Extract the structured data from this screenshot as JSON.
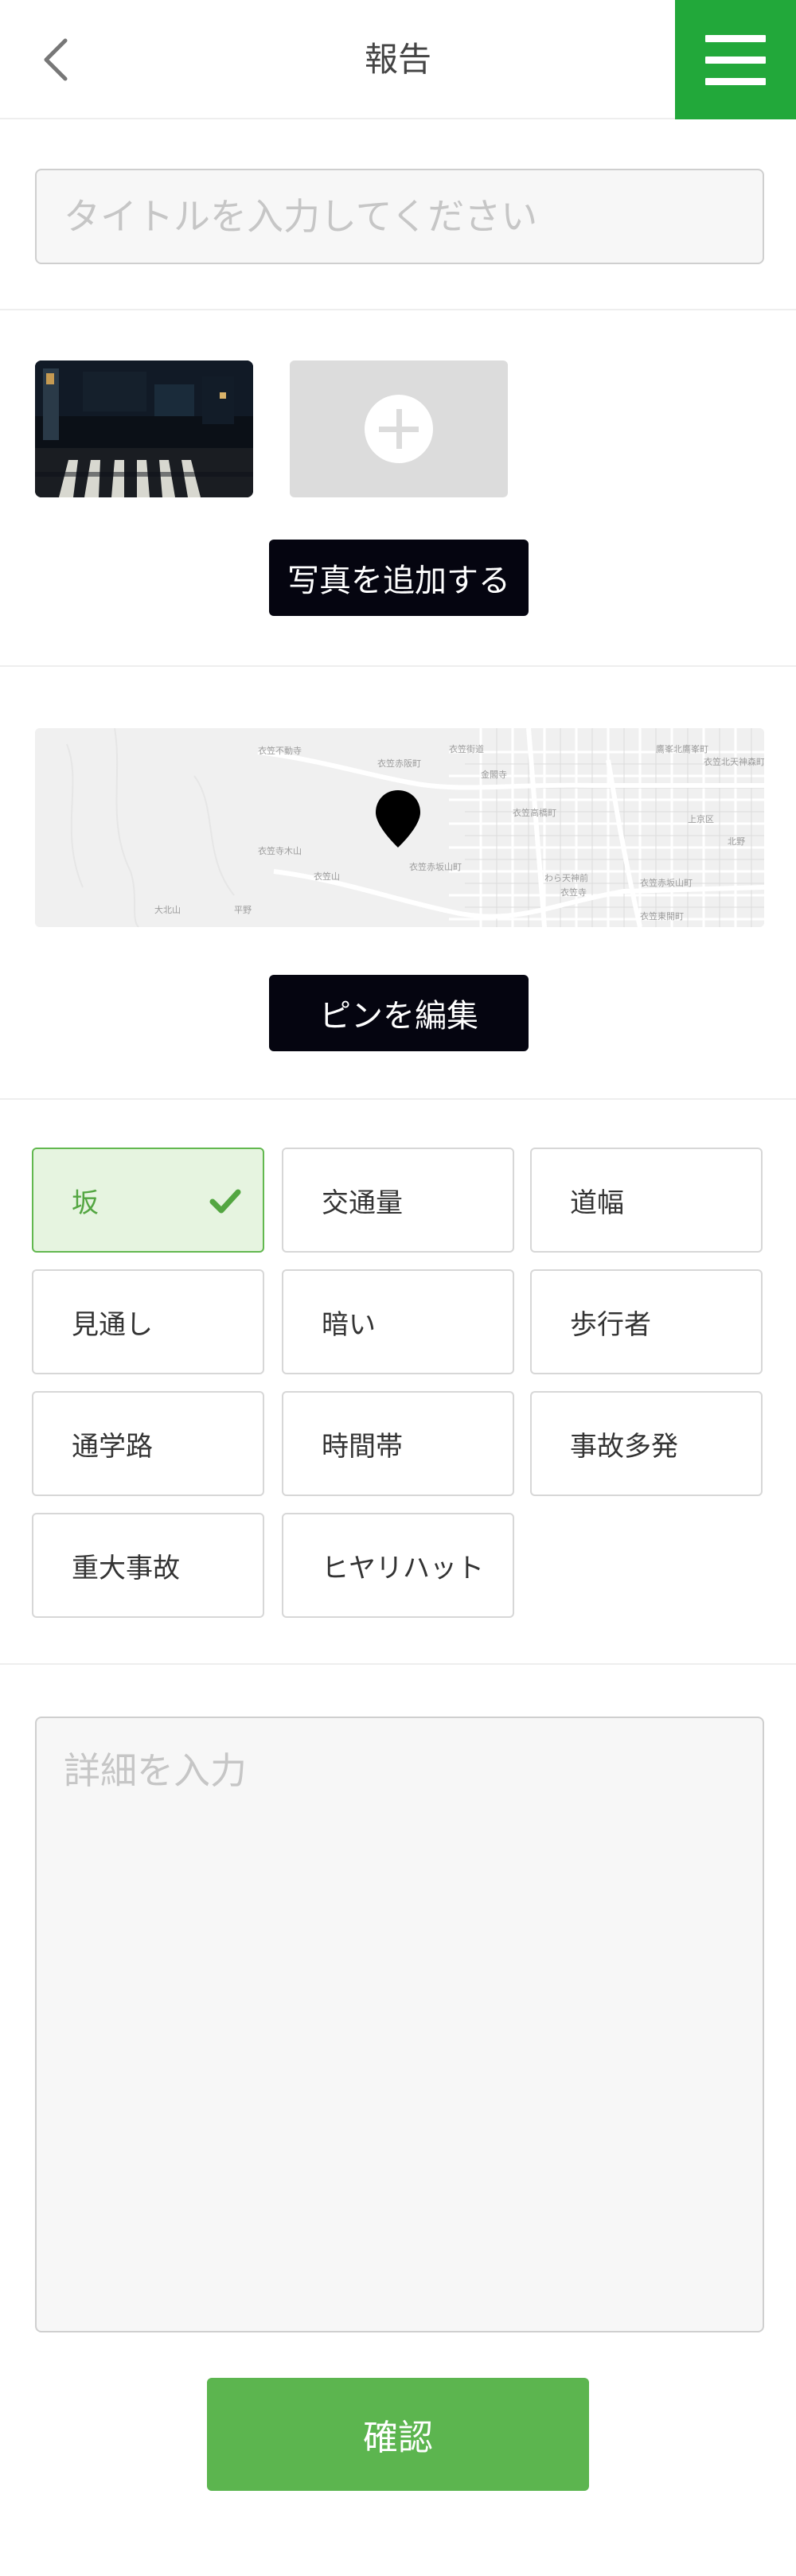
{
  "header": {
    "title": "報告",
    "back_icon": "chevron-left-icon",
    "menu_icon": "hamburger-menu-icon",
    "accent_color": "#22a83a"
  },
  "form": {
    "title_placeholder": "タイトルを入力してください",
    "add_photo_label": "写真を追加する",
    "edit_pin_label": "ピンを編集",
    "details_placeholder": "詳細を入力",
    "confirm_label": "確認"
  },
  "map": {
    "labels": [
      "衣笠不動寺",
      "衣笠赤阪町",
      "金閣寺",
      "衣笠高橋町",
      "鷹峯北鷹峯町",
      "衣笠街道",
      "衣笠寺木山",
      "衣笠山",
      "衣笠赤坂山町",
      "わら天神前",
      "衣笠寺",
      "衣笠赤坂山町",
      "衣笠東開町",
      "大北山",
      "上京区",
      "衣笠北天神森町",
      "北野",
      "平野"
    ]
  },
  "tags": [
    {
      "label": "坂",
      "selected": true
    },
    {
      "label": "交通量",
      "selected": false
    },
    {
      "label": "道幅",
      "selected": false
    },
    {
      "label": "見通し",
      "selected": false
    },
    {
      "label": "暗い",
      "selected": false
    },
    {
      "label": "歩行者",
      "selected": false
    },
    {
      "label": "通学路",
      "selected": false
    },
    {
      "label": "時間帯",
      "selected": false
    },
    {
      "label": "事故多発",
      "selected": false
    },
    {
      "label": "重大事故",
      "selected": false
    },
    {
      "label": "ヒヤリハット",
      "selected": false
    }
  ]
}
